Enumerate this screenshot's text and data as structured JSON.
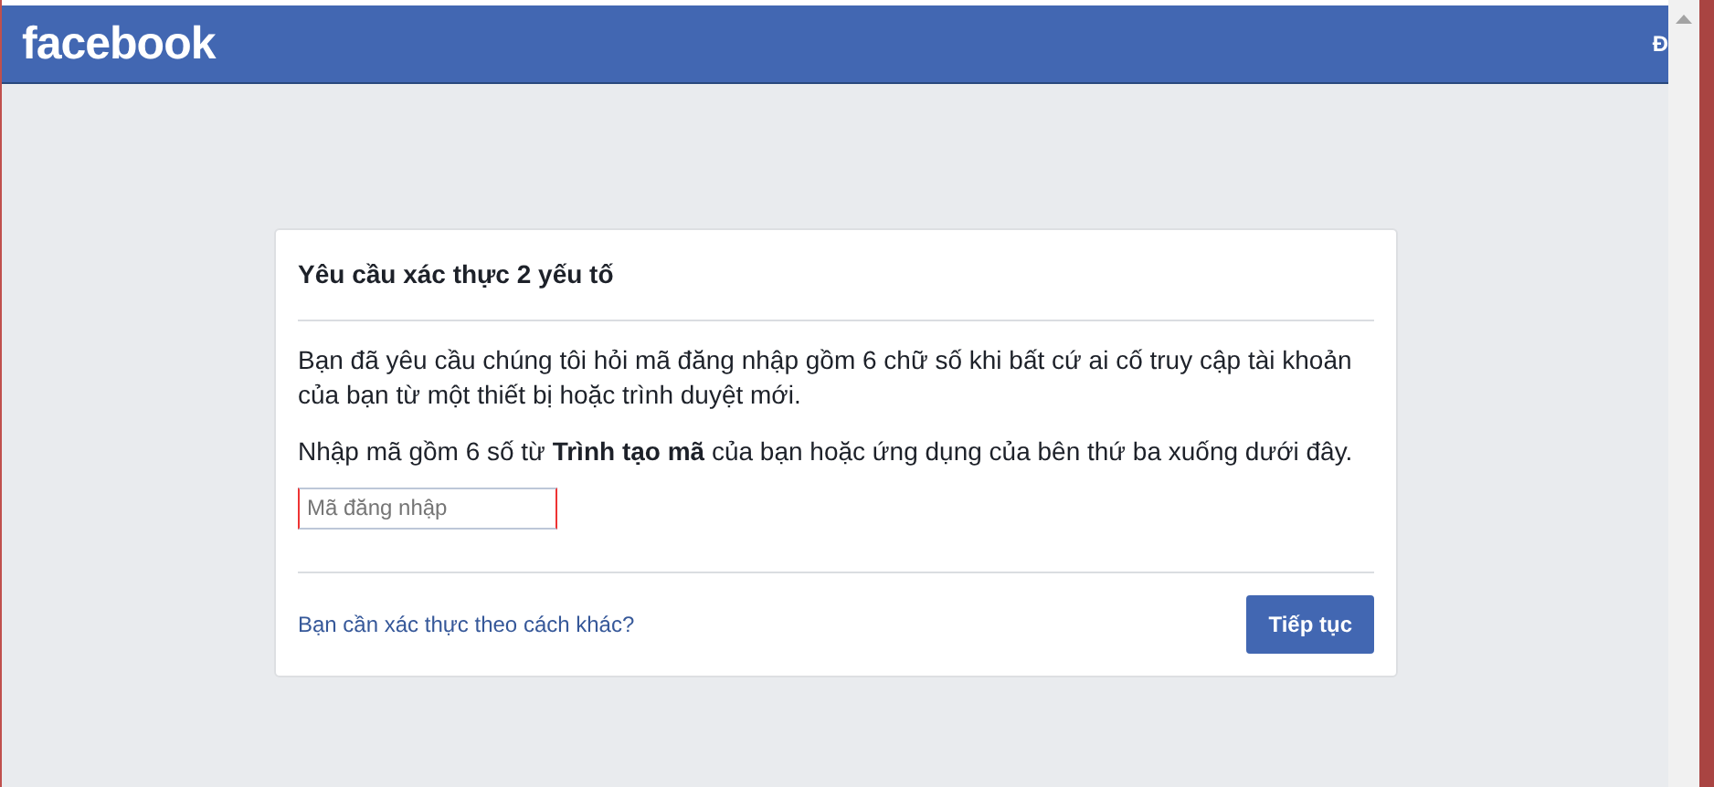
{
  "header": {
    "logo": "facebook",
    "right_text": "Đ"
  },
  "dialog": {
    "title": "Yêu cầu xác thực 2 yếu tố",
    "paragraphs": [
      "Bạn đã yêu cầu chúng tôi hỏi mã đăng nhập gồm 6 chữ số khi bất cứ ai cố truy cập tài khoản của bạn từ một thiết bị hoặc trình duyệt mới.",
      "Nhập mã gồm 6 số từ **Trình tạo mã** của bạn hoặc ứng dụng của bên thứ ba xuống dưới đây."
    ],
    "code_field": {
      "placeholder": "Mã đăng nhập"
    },
    "alt_link": "Bạn cần xác thực theo cách khác?",
    "continue_button": "Tiếp tục"
  }
}
